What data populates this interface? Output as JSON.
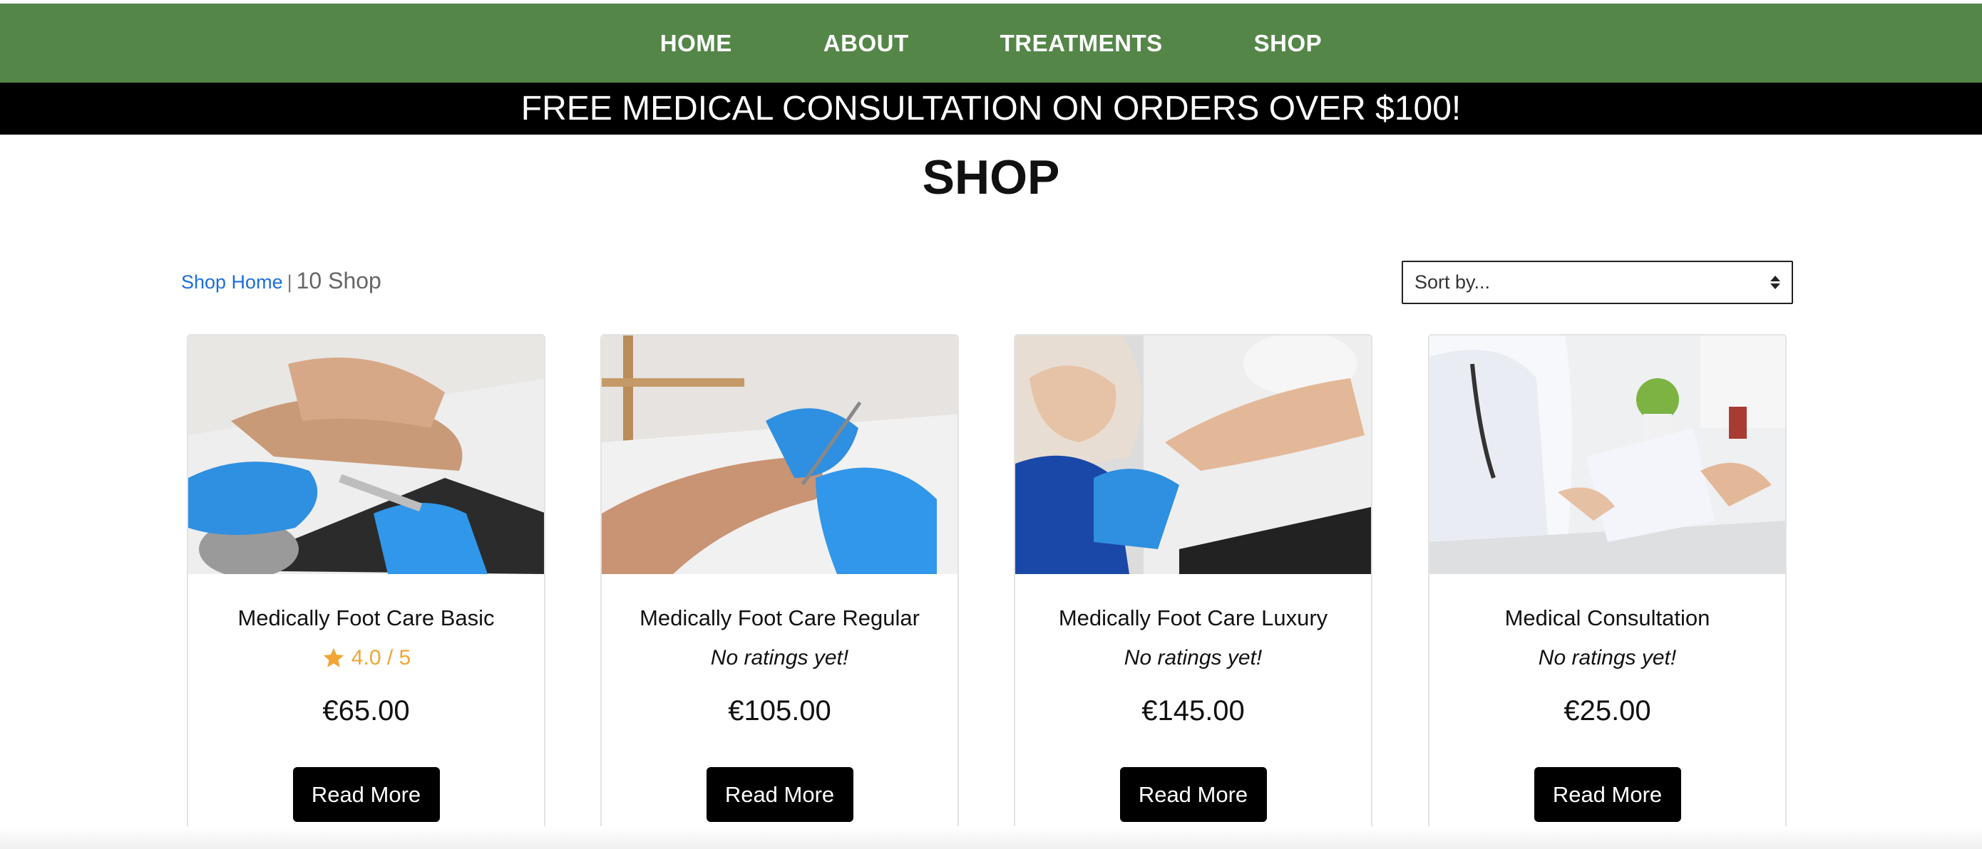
{
  "nav": {
    "items": [
      {
        "label": "HOME"
      },
      {
        "label": "ABOUT"
      },
      {
        "label": "TREATMENTS"
      },
      {
        "label": "SHOP"
      }
    ]
  },
  "promo": {
    "text": "FREE MEDICAL CONSULTATION ON ORDERS OVER $100!"
  },
  "page": {
    "title": "SHOP"
  },
  "breadcrumb": {
    "home_label": "Shop Home",
    "separator": "|",
    "current": "10 Shop"
  },
  "sort": {
    "selected": "Sort by..."
  },
  "colors": {
    "nav_bg": "#548648",
    "promo_bg": "#000000",
    "rating": "#f0a535",
    "link": "#1b6fd8"
  },
  "products": [
    {
      "name": "Medically Foot Care Basic",
      "rating": "4.0 / 5",
      "rated": true,
      "price": "€65.00",
      "button": "Read More",
      "image": "foot-care-basic-photo"
    },
    {
      "name": "Medically Foot Care Regular",
      "rating": "No ratings yet!",
      "rated": false,
      "price": "€105.00",
      "button": "Read More",
      "image": "foot-care-regular-photo"
    },
    {
      "name": "Medically Foot Care Luxury",
      "rating": "No ratings yet!",
      "rated": false,
      "price": "€145.00",
      "button": "Read More",
      "image": "foot-care-luxury-photo"
    },
    {
      "name": "Medical Consultation",
      "rating": "No ratings yet!",
      "rated": false,
      "price": "€25.00",
      "button": "Read More",
      "image": "medical-consultation-photo"
    }
  ]
}
